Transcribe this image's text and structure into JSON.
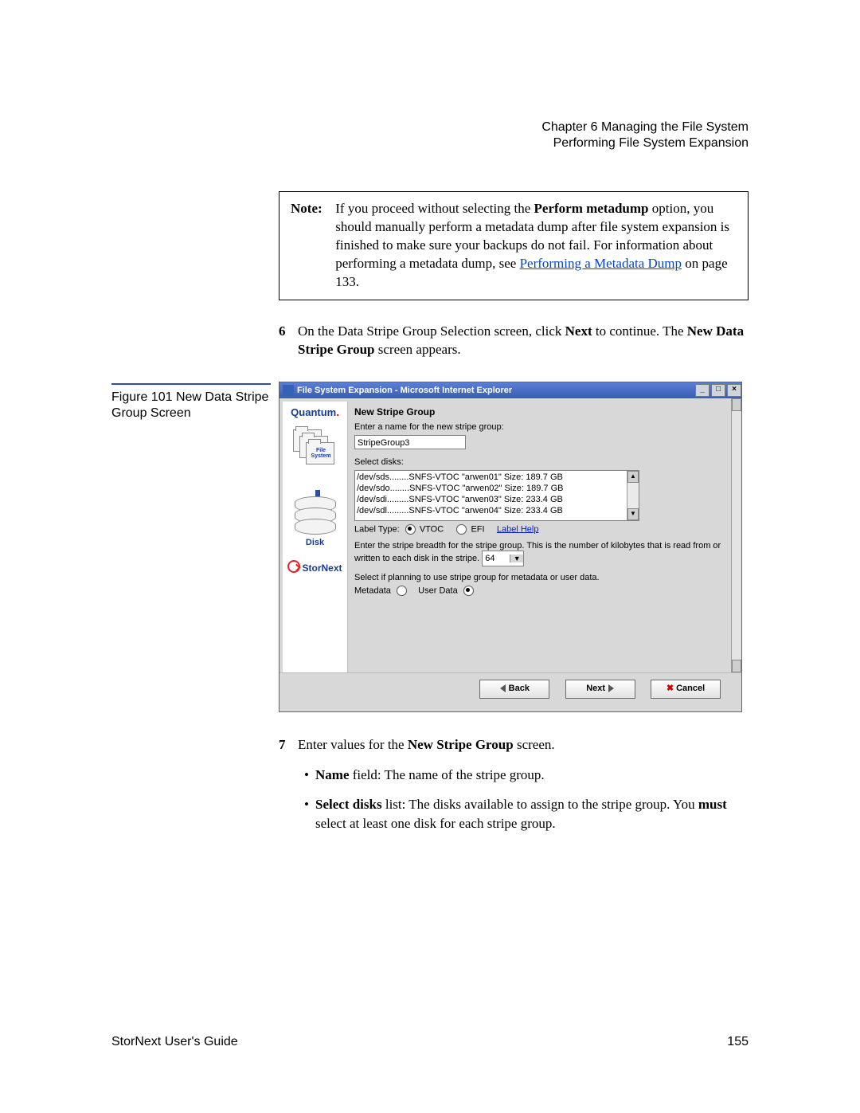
{
  "header": {
    "chapter_line": "Chapter 6  Managing the File System",
    "section_line": "Performing File System Expansion"
  },
  "note": {
    "label": "Note:",
    "text_before_bold": "If you proceed without selecting the ",
    "bold": "Perform metadump",
    "text_mid": " option, you should manually perform a metadata dump after file system expansion is finished to make sure your backups do not fail. For information about performing a metadata dump, see ",
    "link": "Performing a Metadata Dump",
    "text_after": " on page  133."
  },
  "step6": {
    "num": "6",
    "t1": "On the Data Stripe Group Selection screen, click ",
    "b1": "Next",
    "t2": " to continue. The ",
    "b2": "New Data Stripe Group",
    "t3": " screen appears."
  },
  "figure": {
    "caption": "Figure 101  New Data Stripe Group Screen"
  },
  "ie": {
    "title": "File System Expansion - Microsoft Internet Explorer",
    "win_min": "_",
    "win_max": "□",
    "win_close": "×",
    "sidebar": {
      "brand": "Quantum",
      "dot": ".",
      "fs_label": "File System",
      "disk_label": "Disk",
      "product": "StorNext"
    },
    "panel": {
      "title": "New Stripe Group",
      "name_prompt": "Enter a name for the new stripe group:",
      "name_value": "StripeGroup3",
      "disks_prompt": "Select disks:",
      "disks": [
        "/dev/sds........SNFS-VTOC \"arwen01\" Size: 189.7 GB",
        "/dev/sdo........SNFS-VTOC \"arwen02\" Size: 189.7 GB",
        "/dev/sdi.........SNFS-VTOC \"arwen03\" Size: 233.4 GB",
        "/dev/sdl.........SNFS-VTOC \"arwen04\" Size: 233.4 GB"
      ],
      "label_type": "Label Type:",
      "vtoc": "VTOC",
      "efi": "EFI",
      "label_help": "Label Help",
      "breadth_text": "Enter the stripe breadth for the stripe group. This is the number of kilobytes that is read from or written to each disk in the stripe.",
      "breadth_value": "64",
      "usage_prompt": "Select if planning to use stripe group for metadata or user data.",
      "metadata": "Metadata",
      "userdata": "User Data"
    },
    "buttons": {
      "back": "Back",
      "next": "Next",
      "cancel": "Cancel"
    }
  },
  "step7": {
    "num": "7",
    "t1": "Enter values for the ",
    "b1": "New Stripe Group",
    "t2": " screen."
  },
  "bullets": {
    "b1_bold": "Name",
    "b1_rest": " field: The name of the stripe group.",
    "b2_bold": "Select disks",
    "b2_rest": " list: The disks available to assign to the stripe group. You ",
    "b2_bold2": "must",
    "b2_rest2": " select at least one disk for each stripe group."
  },
  "footer": {
    "left": "StorNext User's Guide",
    "right": "155"
  }
}
